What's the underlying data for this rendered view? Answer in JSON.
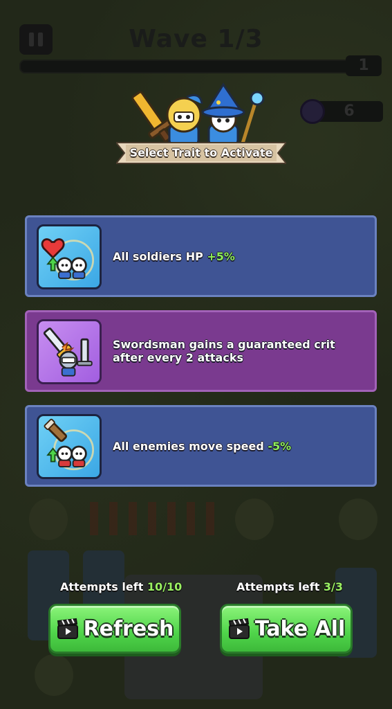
{
  "hud": {
    "wave_title": "Wave 1/3",
    "wave_count": "1",
    "gem_count": "6"
  },
  "header": {
    "banner_text": "Select Trait to Activate"
  },
  "traits": [
    {
      "icon": "heart-soldiers-icon",
      "text_before": "All soldiers HP ",
      "highlight": "+5%",
      "text_after": ""
    },
    {
      "icon": "swordsman-crit-icon",
      "text_before": "Swordsman gains a guaranteed crit after every 2 attacks",
      "highlight": "",
      "text_after": ""
    },
    {
      "icon": "enemy-slow-icon",
      "text_before": "All enemies move speed ",
      "highlight": "-5%",
      "text_after": ""
    }
  ],
  "refresh": {
    "attempts_label": "Attempts left",
    "attempts_value": "10/10",
    "button_label": "Refresh"
  },
  "take_all": {
    "attempts_label": "Attempts left",
    "attempts_value": "3/3",
    "button_label": "Take All"
  },
  "colors": {
    "card_blue": "#3f5494",
    "card_purple": "#7a3a8f",
    "highlight_green": "#8ef05a",
    "button_green": "#4fd44a"
  }
}
